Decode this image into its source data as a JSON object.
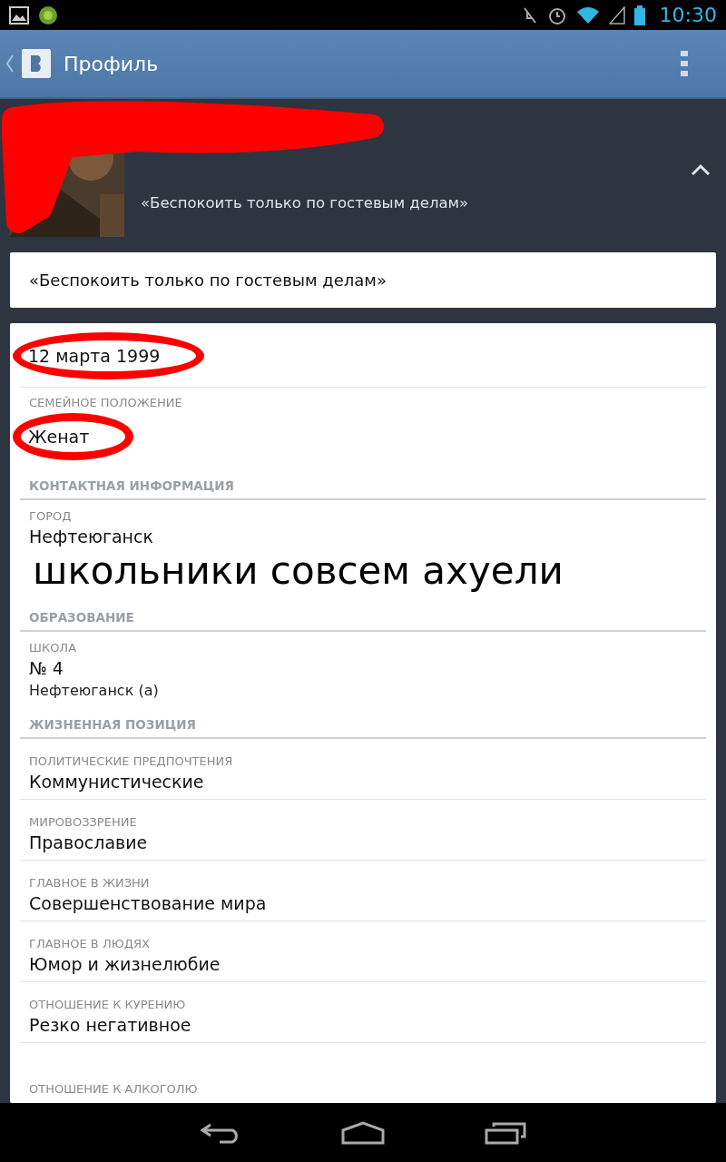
{
  "status_bar": {
    "time": "10:30"
  },
  "app_bar": {
    "title": "Профиль"
  },
  "profile_header": {
    "status": "«Беспокоить только по гостевым делам»",
    "expanded": true
  },
  "status_card": {
    "text": "«Беспокоить только по гостевым делам»"
  },
  "sections": [
    {
      "items": [
        {
          "value": "12 марта 1999",
          "circled": true
        },
        {
          "label": "СЕМЕЙНОЕ ПОЛОЖЕНИЕ",
          "value": "Женат",
          "circled": true
        }
      ]
    },
    {
      "heading": "КОНТАКТНАЯ ИНФОРМАЦИЯ",
      "items": [
        {
          "label": "ГОРОД",
          "value": "Нефтеюганск",
          "caption": "школьники совсем ахуели"
        }
      ]
    },
    {
      "heading": "ОБРАЗОВАНИЕ",
      "items": [
        {
          "label": "ШКОЛА",
          "value": "№ 4",
          "subvalue": "Нефтеюганск (а)"
        }
      ]
    },
    {
      "heading": "ЖИЗНЕННАЯ ПОЗИЦИЯ",
      "items": [
        {
          "label": "ПОЛИТИЧЕСКИЕ ПРЕДПОЧТЕНИЯ",
          "value": "Коммунистические"
        },
        {
          "label": "МИРОВОЗЗРЕНИЕ",
          "value": "Православие"
        },
        {
          "label": "ГЛАВНОЕ В ЖИЗНИ",
          "value": "Совершенствование мира"
        },
        {
          "label": "ГЛАВНОЕ В ЛЮДЯХ",
          "value": "Юмор и жизнелюбие"
        },
        {
          "label": "ОТНОШЕНИЕ К КУРЕНИЮ",
          "value": "Резко негативное"
        },
        {
          "label": "ОТНОШЕНИЕ К АЛКОГОЛЮ"
        }
      ]
    }
  ]
}
